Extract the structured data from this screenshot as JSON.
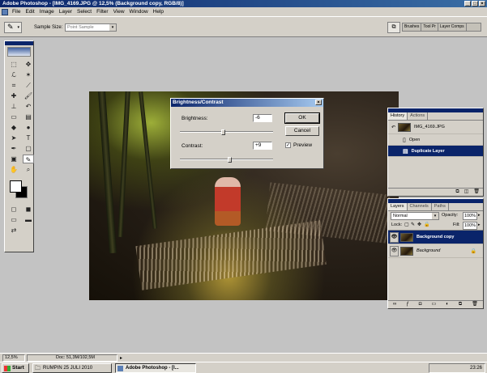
{
  "window": {
    "title": "Adobe Photoshop - [IMG_4169.JPG @ 12,5% (Background copy, RGB/8)]",
    "controls": [
      "_",
      "□",
      "×"
    ]
  },
  "menu": [
    "File",
    "Edit",
    "Image",
    "Layer",
    "Select",
    "Filter",
    "View",
    "Window",
    "Help"
  ],
  "options_bar": {
    "sample_size_label": "Sample Size:",
    "sample_size_value": "Point Sample",
    "well_tabs": [
      "Brushes",
      "Tool Pr",
      "Layer Comps"
    ]
  },
  "brightness_contrast": {
    "title": "Brightness/Contrast",
    "brightness_label": "Brightness:",
    "brightness_value": "-6",
    "contrast_label": "Contrast:",
    "contrast_value": "+9",
    "ok_label": "OK",
    "cancel_label": "Cancel",
    "preview_label": "Preview",
    "preview_checked": true,
    "brightness_pct": 0.47,
    "contrast_pct": 0.54
  },
  "history_panel": {
    "tabs": [
      "History",
      "Actions"
    ],
    "snapshot": "IMG_4169.JPG",
    "states": [
      "Open",
      "Duplicate Layer"
    ],
    "selected_state": "Duplicate Layer"
  },
  "layers_panel": {
    "tabs": [
      "Layers",
      "Channels",
      "Paths"
    ],
    "blend_mode": "Normal",
    "opacity_label": "Opacity:",
    "opacity": "100%",
    "lock_label": "Lock:",
    "fill_label": "Fill:",
    "fill": "100%",
    "layers": [
      "Background copy",
      "Background"
    ],
    "selected_layer": "Background copy"
  },
  "status": {
    "zoom": "12,5%",
    "doc": "Doc: 51,3M/102,5M"
  },
  "taskbar": {
    "start_label": "Start",
    "tasks": [
      "RUMPIN 25 JULI 2010",
      "Adobe Photoshop - [I..."
    ],
    "clock": "23:26"
  }
}
